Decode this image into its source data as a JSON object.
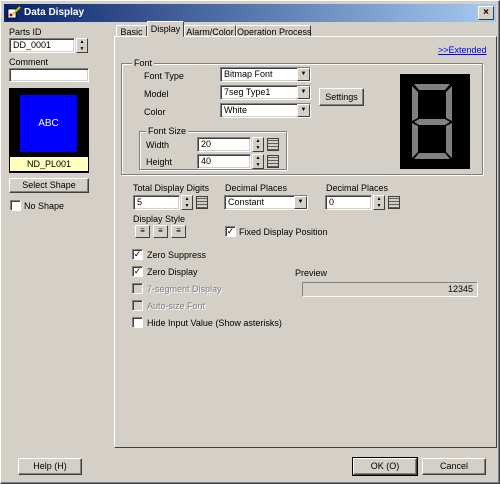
{
  "window": {
    "title": "Data Display",
    "close_glyph": "×"
  },
  "left": {
    "parts_id_label": "Parts ID",
    "parts_id_value": "DD_0001",
    "comment_label": "Comment",
    "comment_value": "",
    "preview_text": "ABC",
    "shape_name": "ND_PL001",
    "select_shape_label": "Select Shape",
    "no_shape_label": "No Shape"
  },
  "tabs": [
    {
      "label": "Basic"
    },
    {
      "label": "Display"
    },
    {
      "label": "Alarm/Color"
    },
    {
      "label": "Operation Process"
    }
  ],
  "extended_link": ">>Extended",
  "font": {
    "group_label": "Font",
    "font_type_label": "Font Type",
    "font_type_value": "Bitmap Font",
    "model_label": "Model",
    "model_value": "7seg Type1",
    "color_label": "Color",
    "color_value": "White",
    "settings_label": "Settings",
    "size_group_label": "Font Size",
    "width_label": "Width",
    "width_value": "20",
    "height_label": "Height",
    "height_value": "40"
  },
  "digits": {
    "label": "Total Display Digits",
    "value": "5"
  },
  "decimal_mode": {
    "label": "Decimal Places",
    "value": "Constant"
  },
  "decimal_count": {
    "label": "Decimal Places",
    "value": "0"
  },
  "display_style_label": "Display Style",
  "fixed_display_position": {
    "label": "Fixed Display Position",
    "checked": "✓"
  },
  "options": {
    "zero_suppress": "Zero Suppress",
    "zero_display": "Zero Display",
    "seven_segment": "7-segment Display",
    "auto_size": "Auto-size Font",
    "hide_input": "Hide Input Value (Show asterisks)",
    "check_mark": "✓"
  },
  "preview": {
    "label": "Preview",
    "value": "12345"
  },
  "footer": {
    "help_label": "Help (H)",
    "ok_label": "OK (O)",
    "cancel_label": "Cancel"
  },
  "colors": {
    "title_start": "#0a246a",
    "title_end": "#a6caf0",
    "preview_blue": "#0000ff",
    "shape_name_bg": "#ffffc0",
    "seg_bg": "#000000",
    "seg_on": "#808080"
  }
}
